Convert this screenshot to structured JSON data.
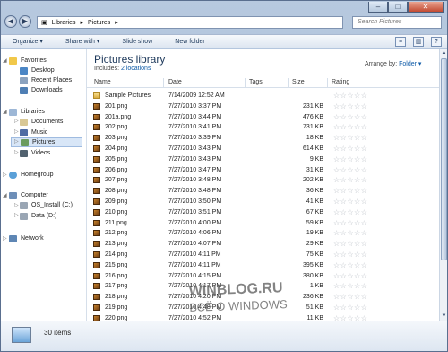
{
  "titlebar": {
    "address": [
      "Libraries",
      "Pictures"
    ],
    "search_placeholder": "Search Pictures",
    "controls": [
      "–",
      "□",
      "✕"
    ]
  },
  "toolbar": {
    "organize": "Organize ▾",
    "share": "Share with ▾",
    "slideshow": "Slide show",
    "newfolder": "New folder"
  },
  "sidebar": {
    "favorites": "Favorites",
    "desktop": "Desktop",
    "recent": "Recent Places",
    "downloads": "Downloads",
    "libraries": "Libraries",
    "documents": "Documents",
    "music": "Music",
    "pictures": "Pictures",
    "videos": "Videos",
    "homegroup": "Homegroup",
    "computer": "Computer",
    "osinstall": "OS_Install (C:)",
    "data": "Data (D:)",
    "network": "Network"
  },
  "library": {
    "title": "Pictures library",
    "includes_label": "Includes:",
    "includes_value": "2 locations",
    "arrange_label": "Arrange by:",
    "arrange_value": "Folder ▾"
  },
  "columns": {
    "name": "Name",
    "date": "Date",
    "tags": "Tags",
    "size": "Size",
    "rating": "Rating"
  },
  "files": [
    {
      "name": "Sample Pictures",
      "date": "7/14/2009 12:52 AM",
      "size": "",
      "rating": "☆☆☆☆☆"
    },
    {
      "name": "201.png",
      "date": "7/27/2010 3:37 PM",
      "size": "231 KB",
      "rating": "☆☆☆☆☆"
    },
    {
      "name": "201a.png",
      "date": "7/27/2010 3:44 PM",
      "size": "476 KB",
      "rating": "☆☆☆☆☆"
    },
    {
      "name": "202.png",
      "date": "7/27/2010 3:41 PM",
      "size": "731 KB",
      "rating": "☆☆☆☆☆"
    },
    {
      "name": "203.png",
      "date": "7/27/2010 3:39 PM",
      "size": "18 KB",
      "rating": "☆☆☆☆☆"
    },
    {
      "name": "204.png",
      "date": "7/27/2010 3:43 PM",
      "size": "614 KB",
      "rating": "☆☆☆☆☆"
    },
    {
      "name": "205.png",
      "date": "7/27/2010 3:43 PM",
      "size": "9 KB",
      "rating": "☆☆☆☆☆"
    },
    {
      "name": "206.png",
      "date": "7/27/2010 3:47 PM",
      "size": "31 KB",
      "rating": "☆☆☆☆☆"
    },
    {
      "name": "207.png",
      "date": "7/27/2010 3:48 PM",
      "size": "202 KB",
      "rating": "☆☆☆☆☆"
    },
    {
      "name": "208.png",
      "date": "7/27/2010 3:48 PM",
      "size": "36 KB",
      "rating": "☆☆☆☆☆"
    },
    {
      "name": "209.png",
      "date": "7/27/2010 3:50 PM",
      "size": "41 KB",
      "rating": "☆☆☆☆☆"
    },
    {
      "name": "210.png",
      "date": "7/27/2010 3:51 PM",
      "size": "67 KB",
      "rating": "☆☆☆☆☆"
    },
    {
      "name": "211.png",
      "date": "7/27/2010 4:00 PM",
      "size": "59 KB",
      "rating": "☆☆☆☆☆"
    },
    {
      "name": "212.png",
      "date": "7/27/2010 4:06 PM",
      "size": "19 KB",
      "rating": "☆☆☆☆☆"
    },
    {
      "name": "213.png",
      "date": "7/27/2010 4:07 PM",
      "size": "29 KB",
      "rating": "☆☆☆☆☆"
    },
    {
      "name": "214.png",
      "date": "7/27/2010 4:11 PM",
      "size": "75 KB",
      "rating": "☆☆☆☆☆"
    },
    {
      "name": "215.png",
      "date": "7/27/2010 4:11 PM",
      "size": "395 KB",
      "rating": "☆☆☆☆☆"
    },
    {
      "name": "216.png",
      "date": "7/27/2010 4:15 PM",
      "size": "380 KB",
      "rating": "☆☆☆☆☆"
    },
    {
      "name": "217.png",
      "date": "7/27/2010 4:17 PM",
      "size": "1 KB",
      "rating": "☆☆☆☆☆"
    },
    {
      "name": "218.png",
      "date": "7/27/2010 4:20 PM",
      "size": "236 KB",
      "rating": "☆☆☆☆☆"
    },
    {
      "name": "219.png",
      "date": "7/27/2010 4:48 PM",
      "size": "51 KB",
      "rating": "☆☆☆☆☆"
    },
    {
      "name": "220.png",
      "date": "7/27/2010 4:52 PM",
      "size": "11 KB",
      "rating": "☆☆☆☆☆"
    }
  ],
  "status": {
    "count": "30 items"
  },
  "watermark": {
    "line1": "WINBLOG.RU",
    "line2": "ВСЁ О WINDOWS"
  }
}
